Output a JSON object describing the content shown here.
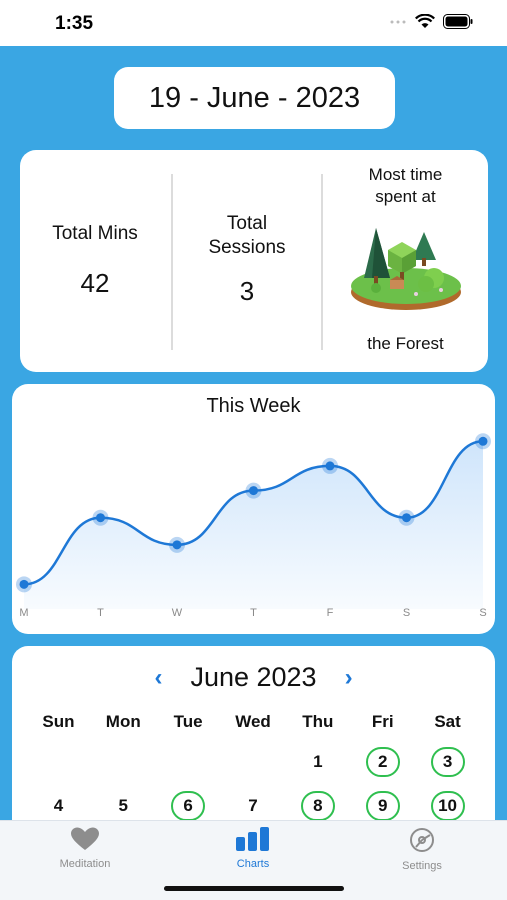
{
  "status": {
    "time": "1:35"
  },
  "date": {
    "label": "19 - June - 2023"
  },
  "stats": {
    "total_mins_label": "Total Mins",
    "total_mins_value": "42",
    "total_sessions_label_1": "Total",
    "total_sessions_label_2": "Sessions",
    "total_sessions_value": "3",
    "most_time_label_1": "Most time",
    "most_time_label_2": "spent at",
    "most_time_place": "the Forest",
    "place_icon": "forest-island-icon"
  },
  "chart_data": {
    "type": "area",
    "title": "This Week",
    "categories": [
      "M",
      "T",
      "W",
      "T",
      "F",
      "S",
      "S"
    ],
    "values": [
      10,
      37,
      26,
      48,
      58,
      37,
      68
    ],
    "ylim": [
      0,
      75
    ],
    "line_color": "#1e78d6",
    "fill_color": "#cfe5fb",
    "grid": false,
    "legend": "none"
  },
  "calendar": {
    "title": "June 2023",
    "prev_icon": "chevron-left-icon",
    "next_icon": "chevron-right-icon",
    "weekdays": [
      "Sun",
      "Mon",
      "Tue",
      "Wed",
      "Thu",
      "Fri",
      "Sat"
    ],
    "days": [
      {
        "d": "",
        "active": false
      },
      {
        "d": "",
        "active": false
      },
      {
        "d": "",
        "active": false
      },
      {
        "d": "",
        "active": false
      },
      {
        "d": "1",
        "active": false
      },
      {
        "d": "2",
        "active": true
      },
      {
        "d": "3",
        "active": true
      },
      {
        "d": "4",
        "active": false
      },
      {
        "d": "5",
        "active": false
      },
      {
        "d": "6",
        "active": true
      },
      {
        "d": "7",
        "active": false
      },
      {
        "d": "8",
        "active": true
      },
      {
        "d": "9",
        "active": true
      },
      {
        "d": "10",
        "active": true
      }
    ],
    "active_color": "#2fbf4f"
  },
  "tabs": {
    "meditation": "Meditation",
    "charts": "Charts",
    "settings": "Settings",
    "accent": "#1e78d6"
  }
}
